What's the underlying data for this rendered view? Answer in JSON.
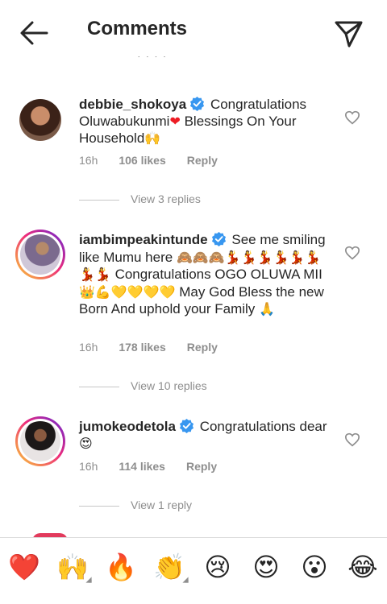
{
  "header": {
    "title": "Comments",
    "faded_text": "· · · ·"
  },
  "comments": [
    {
      "username": "debbie_shokoya",
      "text": "Congratulations Oluwabukunmi",
      "emoji1": "❤",
      "text2": " Blessings On Your Household",
      "emoji2": "🙌",
      "time": "16h",
      "likes": "106 likes",
      "reply": "Reply",
      "view_replies": "View 3 replies",
      "avatar_color": "#5a3a2c"
    },
    {
      "username": "iambimpeakintunde",
      "text": "See me smiling like Mumu here ",
      "emoji1": "🙈🙈🙈💃💃💃💃💃💃💃💃",
      "text2": " Congratulations OGO OLUWA MII ",
      "emoji2": "👑💪💛💛💛💛",
      "text3": " May God Bless the new Born And uphold your Family ",
      "emoji3": "🙏",
      "time": "16h",
      "likes": "178 likes",
      "reply": "Reply",
      "view_replies": "View 10 replies",
      "avatar_color": "#7b6a8e"
    },
    {
      "username": "jumokeodetola",
      "text": "Congratulations dear ",
      "emoji1": "😍",
      "time": "16h",
      "likes": "114 likes",
      "reply": "Reply",
      "view_replies": "View 1 reply",
      "avatar_color": "#2e2a2a"
    }
  ],
  "reactions": [
    "❤️",
    "🙌",
    "🔥",
    "👏",
    "😢",
    "😍",
    "😮",
    "😂"
  ],
  "colors": {
    "verified": "#3897f0",
    "muted": "#8e8e8e",
    "heart": "#ed4956"
  }
}
